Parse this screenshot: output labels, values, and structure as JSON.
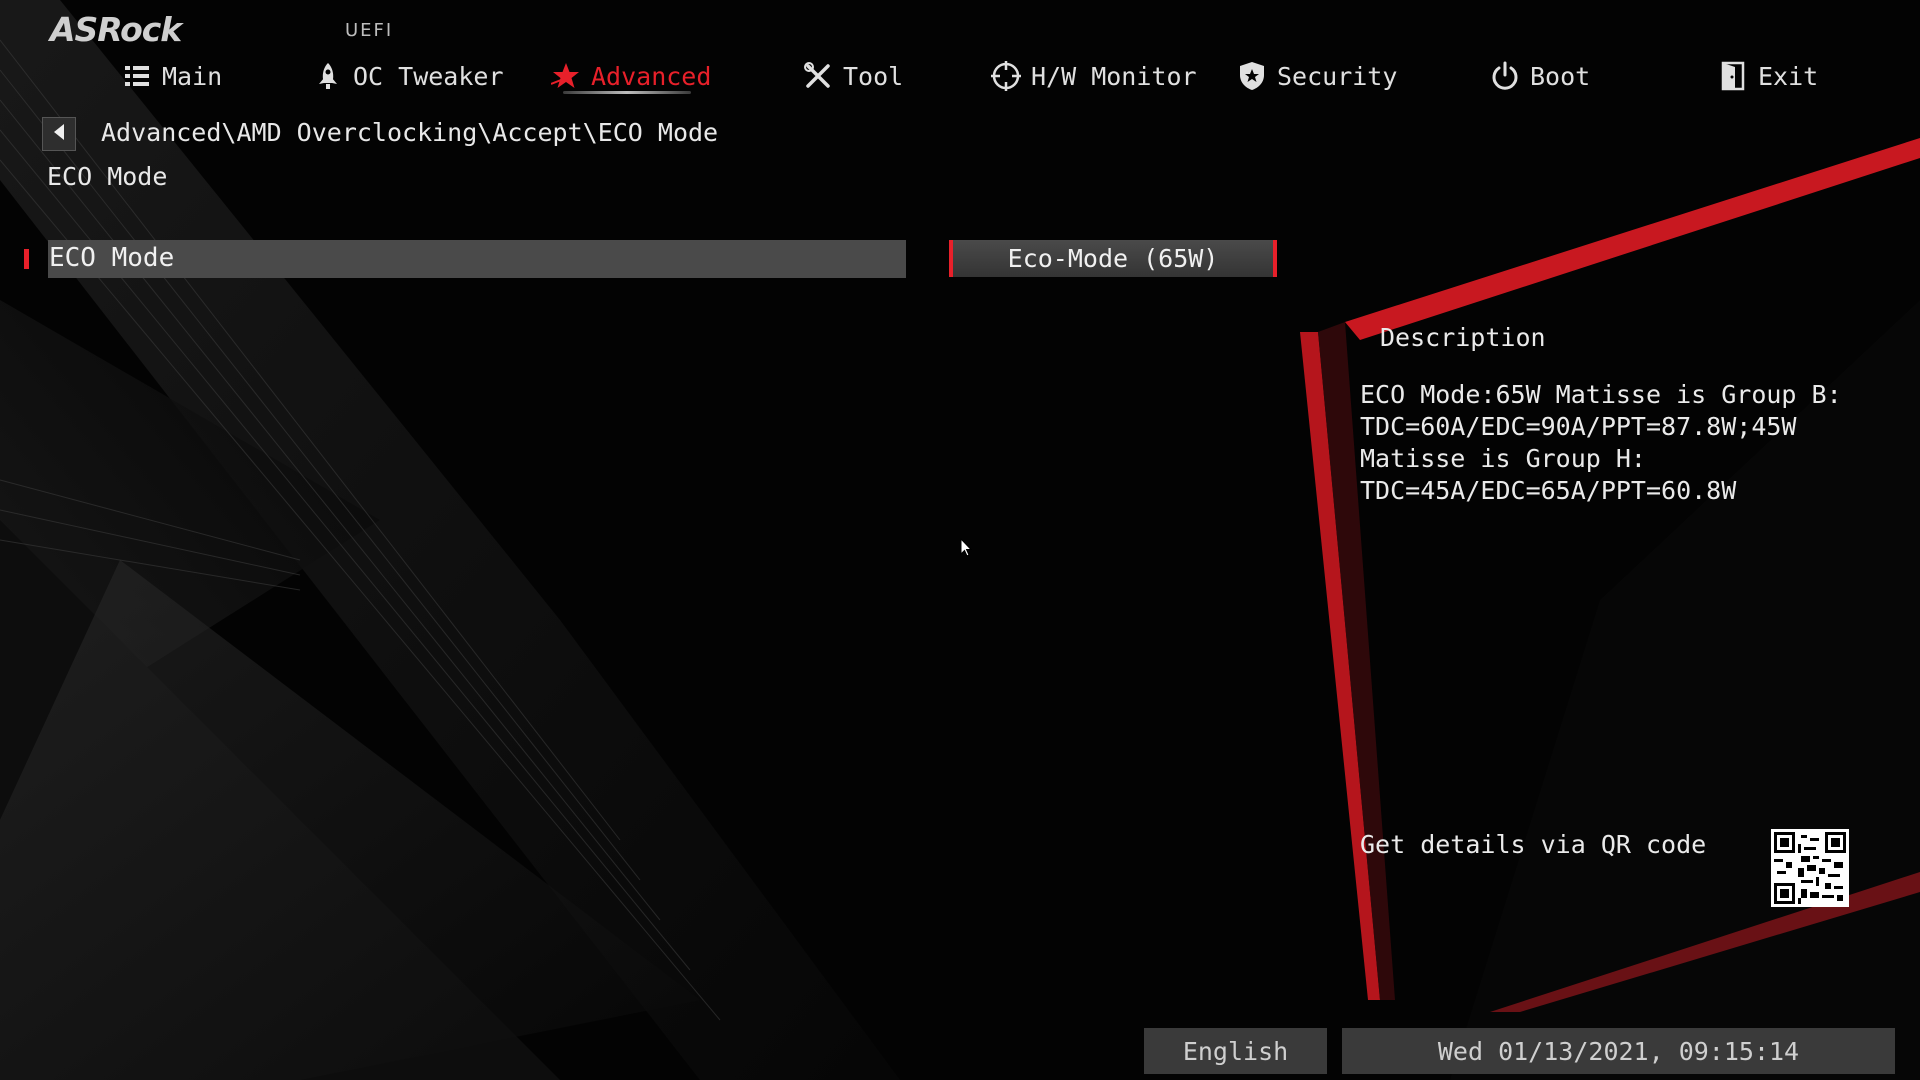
{
  "header": {
    "brand": "ASRock",
    "firmware": "UEFI",
    "nav": [
      {
        "label": "Main",
        "icon": "list-icon"
      },
      {
        "label": "OC Tweaker",
        "icon": "rocket-icon"
      },
      {
        "label": "Advanced",
        "icon": "star-icon",
        "active": true
      },
      {
        "label": "Tool",
        "icon": "tools-icon"
      },
      {
        "label": "H/W Monitor",
        "icon": "crosshair-icon"
      },
      {
        "label": "Security",
        "icon": "shield-icon"
      },
      {
        "label": "Boot",
        "icon": "power-icon"
      },
      {
        "label": "Exit",
        "icon": "exit-door-icon"
      }
    ]
  },
  "breadcrumb": "Advanced\\AMD Overclocking\\Accept\\ECO Mode",
  "page_title": "ECO Mode",
  "options": [
    {
      "label": "ECO Mode",
      "value": "Eco-Mode (65W)"
    }
  ],
  "description": {
    "title": "Description",
    "lines": [
      "ECO Mode:65W Matisse is Group B:",
      "TDC=60A/EDC=90A/PPT=87.8W;45W",
      "Matisse is Group H:",
      "TDC=45A/EDC=65A/PPT=60.8W"
    ],
    "qr_text": "Get details via QR code"
  },
  "footer": {
    "language": "English",
    "datetime": "Wed 01/13/2021, 09:15:14"
  },
  "colors": {
    "accent": "#e8202a",
    "background": "#030303",
    "bar": "#4a4a4a"
  }
}
